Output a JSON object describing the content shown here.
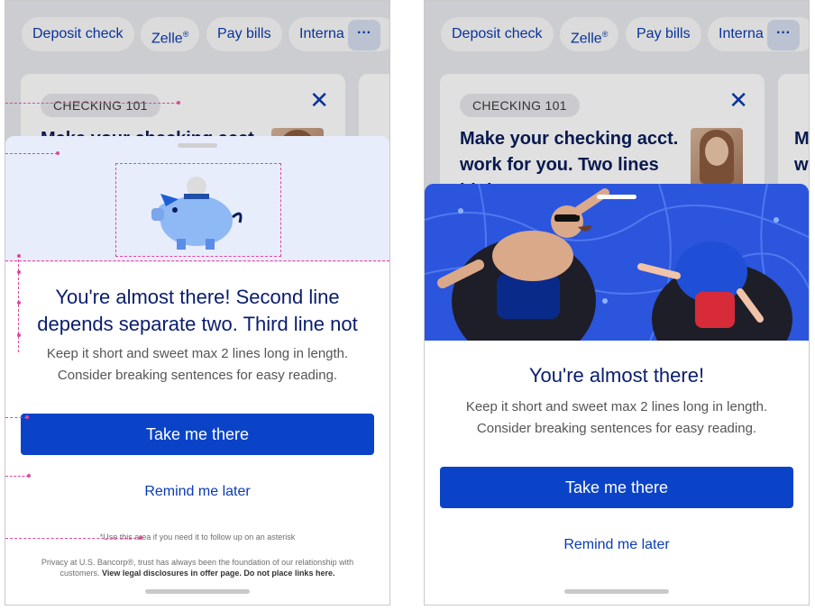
{
  "quick_actions": {
    "deposit_check": "Deposit check",
    "zelle": "Zelle",
    "zelle_mark": "®",
    "pay_bills": "Pay bills",
    "international": "Interna",
    "more": "···"
  },
  "promo_card": {
    "badge": "CHECKING 101",
    "close": "✕",
    "headline": "Make your checking acct. work for you. Two lines high",
    "headline_partial": "Make your checking acct.",
    "peek_text": "M\nw"
  },
  "sheet_left": {
    "title": "You're almost there! Second line depends separate two. Third line not",
    "body": "Keep it short and sweet max 2 lines long in length. Consider breaking sentences for easy reading.",
    "primary_button": "Take me there",
    "secondary_button": "Remind me later",
    "footnote": "*Use this area if you need it to follow up on an asterisk",
    "legal_text": "Privacy at U.S. Bancorp®, trust has always been the foundation of our relationship with customers.",
    "legal_link": "View legal disclosures in offer page. Do not place links here."
  },
  "sheet_right": {
    "title": "You're almost there!",
    "body": "Keep it short and sweet max 2 lines long in length. Consider breaking sentences for easy reading.",
    "primary_button": "Take me there",
    "secondary_button": "Remind me later"
  },
  "colors": {
    "brand_blue": "#0a43c8",
    "title_navy": "#0a1d6e",
    "hero_light": "#e8edfc",
    "hero_pool": "#2b55dd",
    "annotation_pink": "#e0479e"
  }
}
